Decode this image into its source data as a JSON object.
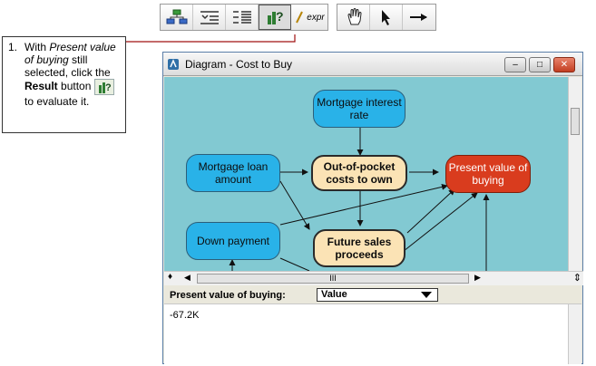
{
  "toolbar": {
    "items": [
      {
        "name": "diagram-view-button",
        "icon": "diagram-icon"
      },
      {
        "name": "outline-view-button",
        "icon": "outline-icon"
      },
      {
        "name": "attributes-view-button",
        "icon": "attributes-icon"
      },
      {
        "name": "result-button",
        "icon": "result-icon"
      },
      {
        "name": "expression-button",
        "icon": "expression-icon",
        "label": "expr"
      },
      {
        "name": "browse-tool-button",
        "icon": "hand-icon"
      },
      {
        "name": "edit-tool-button",
        "icon": "arrow-cursor-icon"
      },
      {
        "name": "arrow-tool-button",
        "icon": "arrow-link-icon"
      }
    ]
  },
  "callout": {
    "number": "1.",
    "line1_prefix": "With ",
    "line1_italic": "Present value of buying",
    "line2": " still selected, click the ",
    "bold": "Result",
    "line3": " button",
    "line4": " to evaluate it."
  },
  "window": {
    "title": "Diagram - Cost to Buy",
    "minimize": "‒",
    "maximize": "□",
    "close": "✕"
  },
  "nodes": {
    "mortgage_interest": "Mortgage interest rate",
    "mortgage_loan": "Mortgage loan amount",
    "out_of_pocket": "Out-of-pocket costs to own",
    "present_value": "Present value of buying",
    "down_payment": "Down payment",
    "future_sales": "Future sales proceeds"
  },
  "scrollbar": {
    "thumb_label": "III"
  },
  "results": {
    "label": "Present value of buying:",
    "selector_value": "Value",
    "value": "-67.2K"
  },
  "colors": {
    "canvas": "#82c9d2",
    "input_node": "#29b2e8",
    "objective_node": "#fbe3b5",
    "result_node": "#d93c1e",
    "callout_line": "#a01010"
  }
}
